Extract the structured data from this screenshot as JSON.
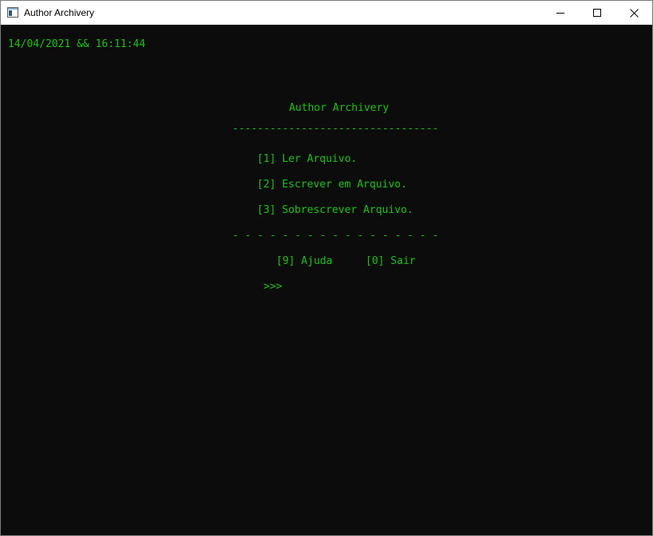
{
  "window": {
    "title": "Author Archivery",
    "controls": {
      "minimize_icon": "minimize-icon",
      "maximize_icon": "maximize-icon",
      "close_icon": "close-icon"
    }
  },
  "console": {
    "datetime": "14/04/2021 && 16:11:44",
    "menu_title": "Author Archivery",
    "rule_solid": "---------------------------------",
    "options": [
      {
        "label": "[1] Ler Arquivo."
      },
      {
        "label": "[2] Escrever em Arquivo."
      },
      {
        "label": "[3] Sobrescrever Arquivo."
      }
    ],
    "rule_dashed": "- - - - - - - - - - - - - - - - -",
    "help": "[9] Ajuda",
    "exit": "[0] Sair",
    "prompt": ">>>"
  },
  "colors": {
    "console_background": "#0c0c0c",
    "console_text": "#16c60c",
    "titlebar_background": "#ffffff"
  }
}
